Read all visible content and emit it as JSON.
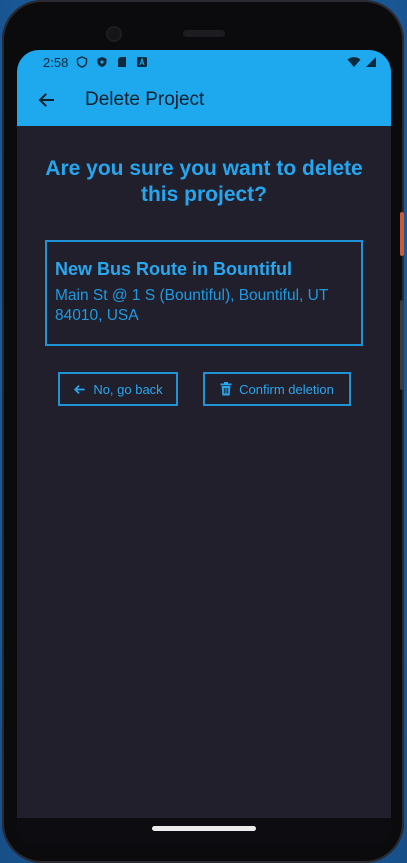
{
  "status_bar": {
    "time": "2:58",
    "icons": [
      "shield-outline-icon",
      "shield-filled-icon",
      "sd-card-icon",
      "a-box-icon"
    ],
    "right_icons": [
      "wifi-icon",
      "cell-signal-icon"
    ]
  },
  "app_bar": {
    "title": "Delete Project",
    "background": "#1ea8ee"
  },
  "dialog": {
    "heading": "Are you sure you want to delete this project?",
    "project": {
      "name": "New Bus Route in Bountiful",
      "address": "Main St @ 1 S (Bountiful), Bountiful, UT 84010, USA"
    },
    "buttons": {
      "back_label": "No, go back",
      "confirm_label": "Confirm deletion"
    }
  },
  "colors": {
    "accent": "#26a6ee",
    "screen_background": "#221f2c"
  }
}
